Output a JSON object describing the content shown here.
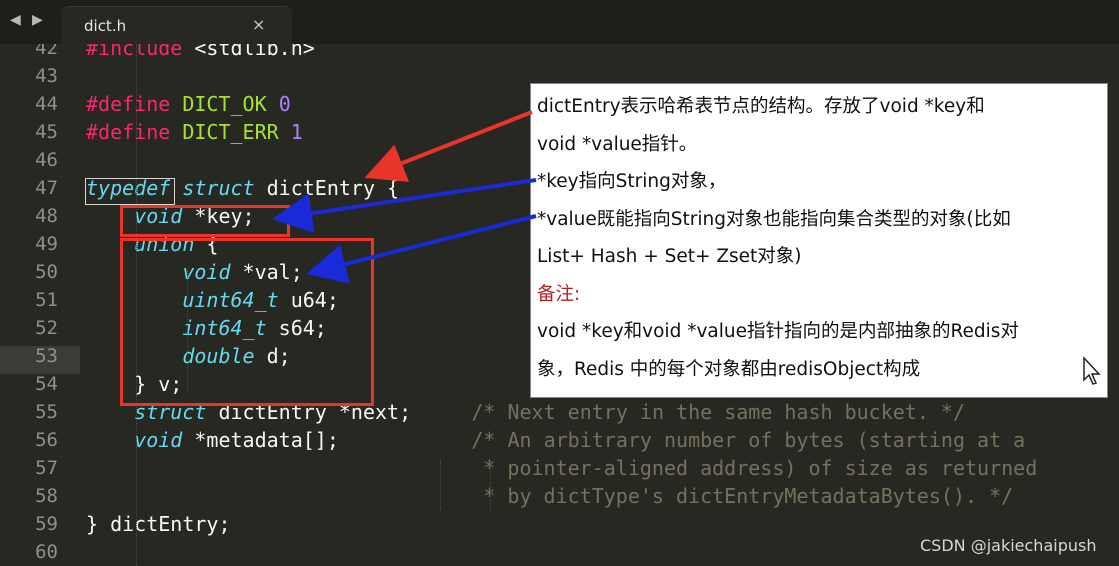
{
  "tabbar": {
    "back_glyph": "◀",
    "forward_glyph": "▶",
    "tab_title": "dict.h",
    "close_glyph": "×"
  },
  "editor": {
    "lines": [
      {
        "no": "42",
        "text": "#include <stdlib.h>"
      },
      {
        "no": "43",
        "text": ""
      },
      {
        "no": "44",
        "text": "#define DICT_OK 0"
      },
      {
        "no": "45",
        "text": "#define DICT_ERR 1"
      },
      {
        "no": "46",
        "text": ""
      },
      {
        "no": "47",
        "text": "typedef struct dictEntry {"
      },
      {
        "no": "48",
        "text": "    void *key;"
      },
      {
        "no": "49",
        "text": "    union {"
      },
      {
        "no": "50",
        "text": "        void *val;"
      },
      {
        "no": "51",
        "text": "        uint64_t u64;"
      },
      {
        "no": "52",
        "text": "        int64_t s64;"
      },
      {
        "no": "53",
        "text": "        double d;"
      },
      {
        "no": "54",
        "text": "    } v;"
      },
      {
        "no": "55",
        "text": "    struct dictEntry *next;     /* Next entry in the same hash bucket. */"
      },
      {
        "no": "56",
        "text": "    void *metadata[];           /* An arbitrary number of bytes (starting at a"
      },
      {
        "no": "57",
        "text": "                                 * pointer-aligned address) of size as returned"
      },
      {
        "no": "58",
        "text": "                                 * by dictType's dictEntryMetadataBytes(). */"
      },
      {
        "no": "59",
        "text": "} dictEntry;"
      },
      {
        "no": "60",
        "text": ""
      }
    ],
    "current_line": "53"
  },
  "annotation": {
    "line1": "dictEntry表示哈希表节点的结构。存放了void *key和",
    "line2": "void *value指针。",
    "line3": "*key指向String对象，",
    "line4": "*value既能指向String对象也能指向集合类型的对象(比如",
    "line5": "List+ Hash + Set+ Zset对象)",
    "line6": "备注:",
    "line7": "void *key和void *value指针指向的是内部抽象的Redis对",
    "line8": "象，Redis 中的每个对象都由redisObject构成"
  },
  "watermark": "CSDN @jakiechaipush",
  "colors": {
    "background": "#272822",
    "keyword": "#66d9ef",
    "preprocessor": "#f92672",
    "macro": "#a6e22e",
    "number": "#ae81ff",
    "comment": "#75715e",
    "highlight_box": "#e8352a",
    "arrow_blue": "#1a2ad8",
    "arrow_red": "#e8352a"
  }
}
